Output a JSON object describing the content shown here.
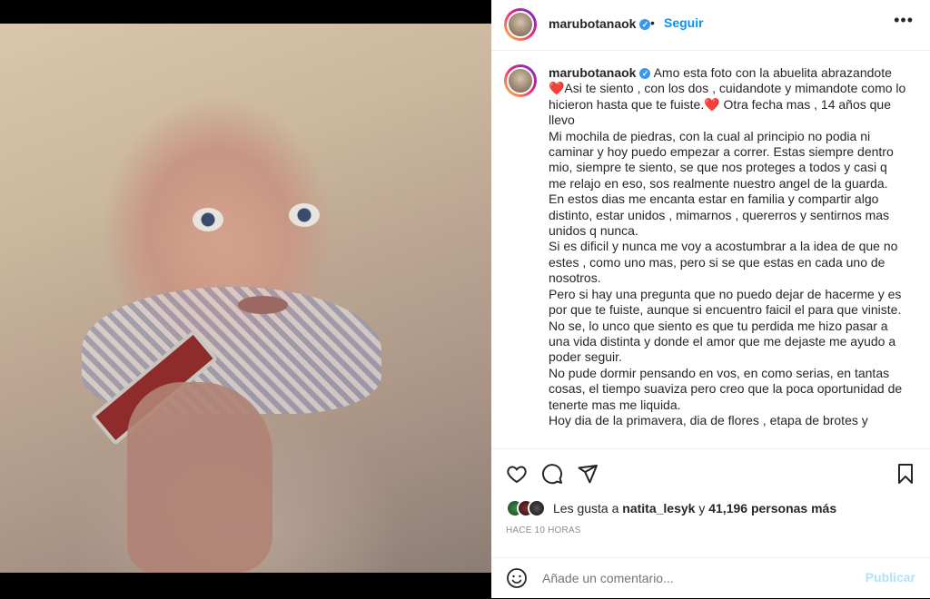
{
  "post": {
    "username": "marubotanaok",
    "follow_label": "Seguir",
    "separator": "•",
    "more_label": "•••",
    "caption_user": "marubotanaok",
    "caption_text": " Amo esta foto con la abuelita abrazandote\n❤️Asi te siento , con los dos , cuidandote y mimandote como lo hicieron hasta que te fuiste.❤️ Otra fecha mas , 14 años que llevo\nMi mochila de piedras, con la cual al principio no podia ni caminar y hoy puedo empezar a correr. Estas siempre dentro mio, siempre te siento, se que nos proteges a todos y casi q me relajo en eso, sos realmente nuestro angel de la guarda.\nEn estos dias me encanta estar en familia y compartir algo distinto, estar unidos , mimarnos , quererros y sentirnos mas unidos q nunca.\nSi es dificil y nunca me voy a acostumbrar a la idea de que no estes , como uno mas, pero si se que estas en cada uno de nosotros.\nPero si hay una pregunta que no puedo dejar de hacerme y es por que te fuiste, aunque si encuentro faicil el para que viniste.\nNo se, lo unco que siento es que tu perdida me hizo pasar a una vida distinta y donde el amor que me dejaste me ayudo a poder seguir.\nNo pude dormir pensando en vos, en como serias, en tantas cosas, el tiempo suaviza pero creo que la poca oportunidad de tenerte mas me liquida.\nHoy dia de la primavera, dia de flores , etapa de brotes y"
  },
  "likes": {
    "prefix": "Les gusta a ",
    "liker": "natita_lesyk",
    "connector": " y ",
    "count_text": "41,196 personas más"
  },
  "timestamp": "HACE 10 HORAS",
  "comment_box": {
    "placeholder": "Añade un comentario...",
    "publish_label": "Publicar"
  },
  "icons": {
    "like": "heart-icon",
    "comment": "comment-bubble-icon",
    "share": "paper-plane-icon",
    "save": "bookmark-icon",
    "emoji": "smiley-icon",
    "verified": "verified-badge-icon"
  },
  "colors": {
    "accent": "#0095f6",
    "publish_disabled": "#b2dffc",
    "muted": "#8e8e8e",
    "text": "#262626"
  }
}
